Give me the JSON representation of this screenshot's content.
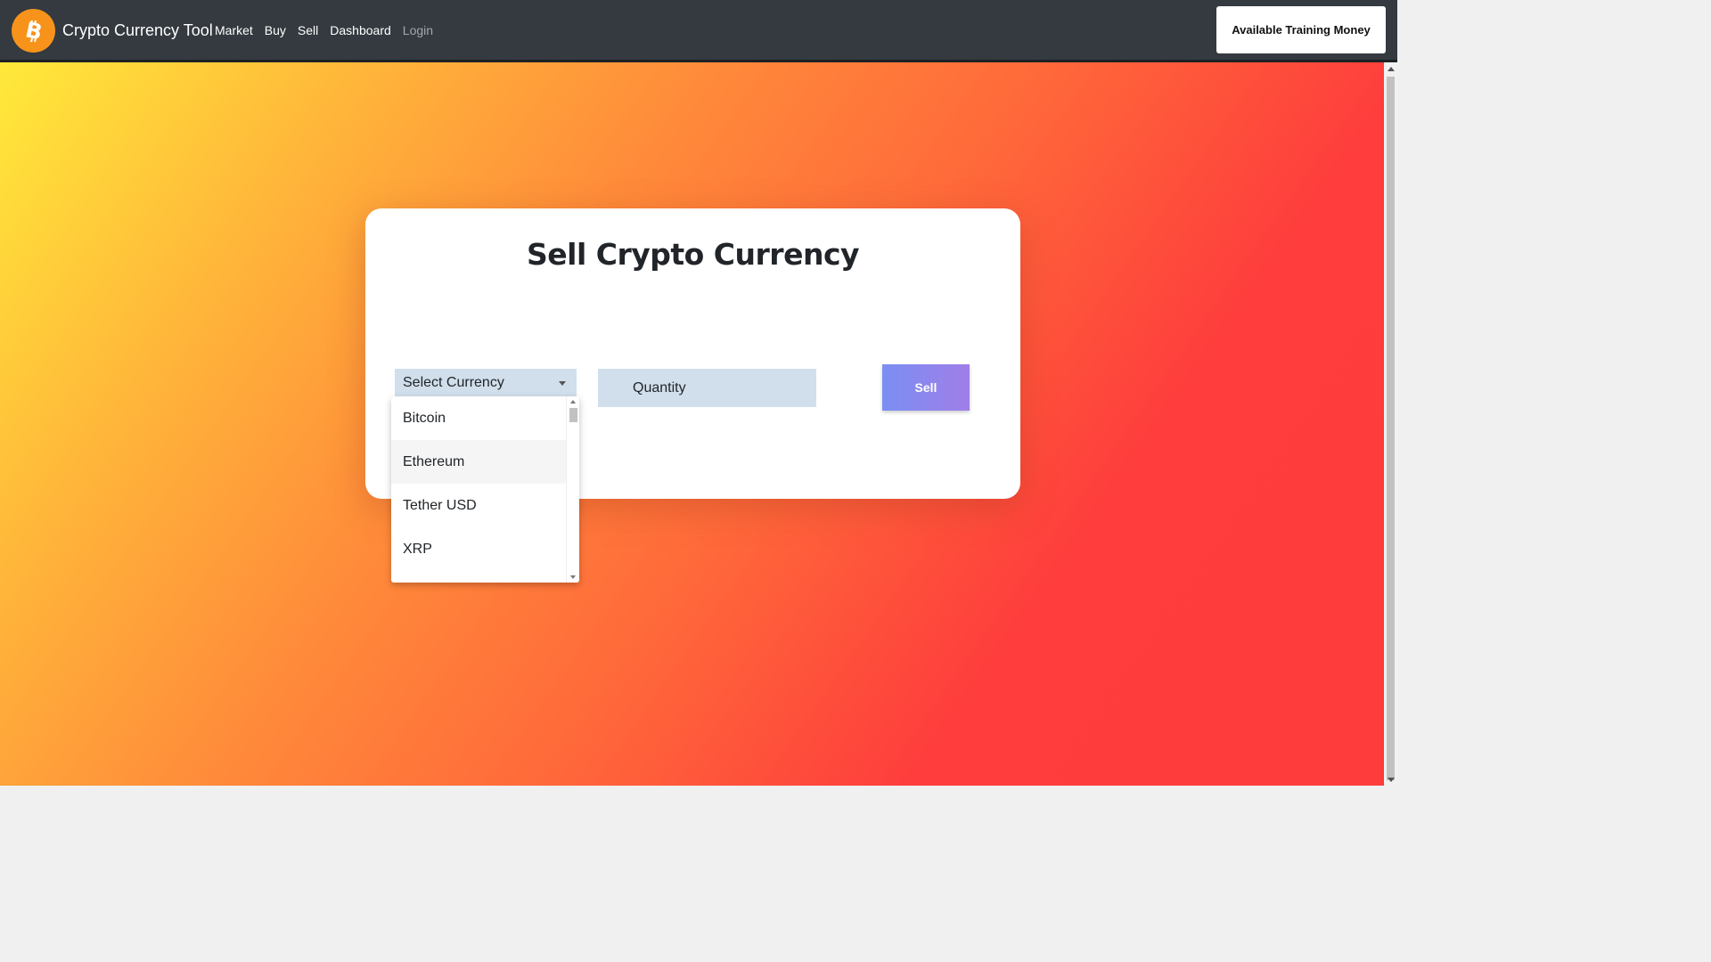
{
  "navbar": {
    "brand": "Crypto Currency Tool",
    "links": [
      {
        "label": "Market"
      },
      {
        "label": "Buy"
      },
      {
        "label": "Sell"
      },
      {
        "label": "Dashboard"
      },
      {
        "label": "Login"
      }
    ],
    "money_button": "Available Training Money",
    "logo_icon": "bitcoin-logo-icon",
    "logo_color": "#f7931a"
  },
  "card": {
    "title": "Sell Crypto Currency",
    "select_placeholder": "Select Currency",
    "quantity_placeholder": "Quantity",
    "sell_button": "Sell"
  },
  "dropdown": {
    "options": [
      {
        "label": "Bitcoin"
      },
      {
        "label": "Ethereum"
      },
      {
        "label": "Tether USD"
      },
      {
        "label": "XRP"
      }
    ],
    "hovered": "Ethereum"
  }
}
